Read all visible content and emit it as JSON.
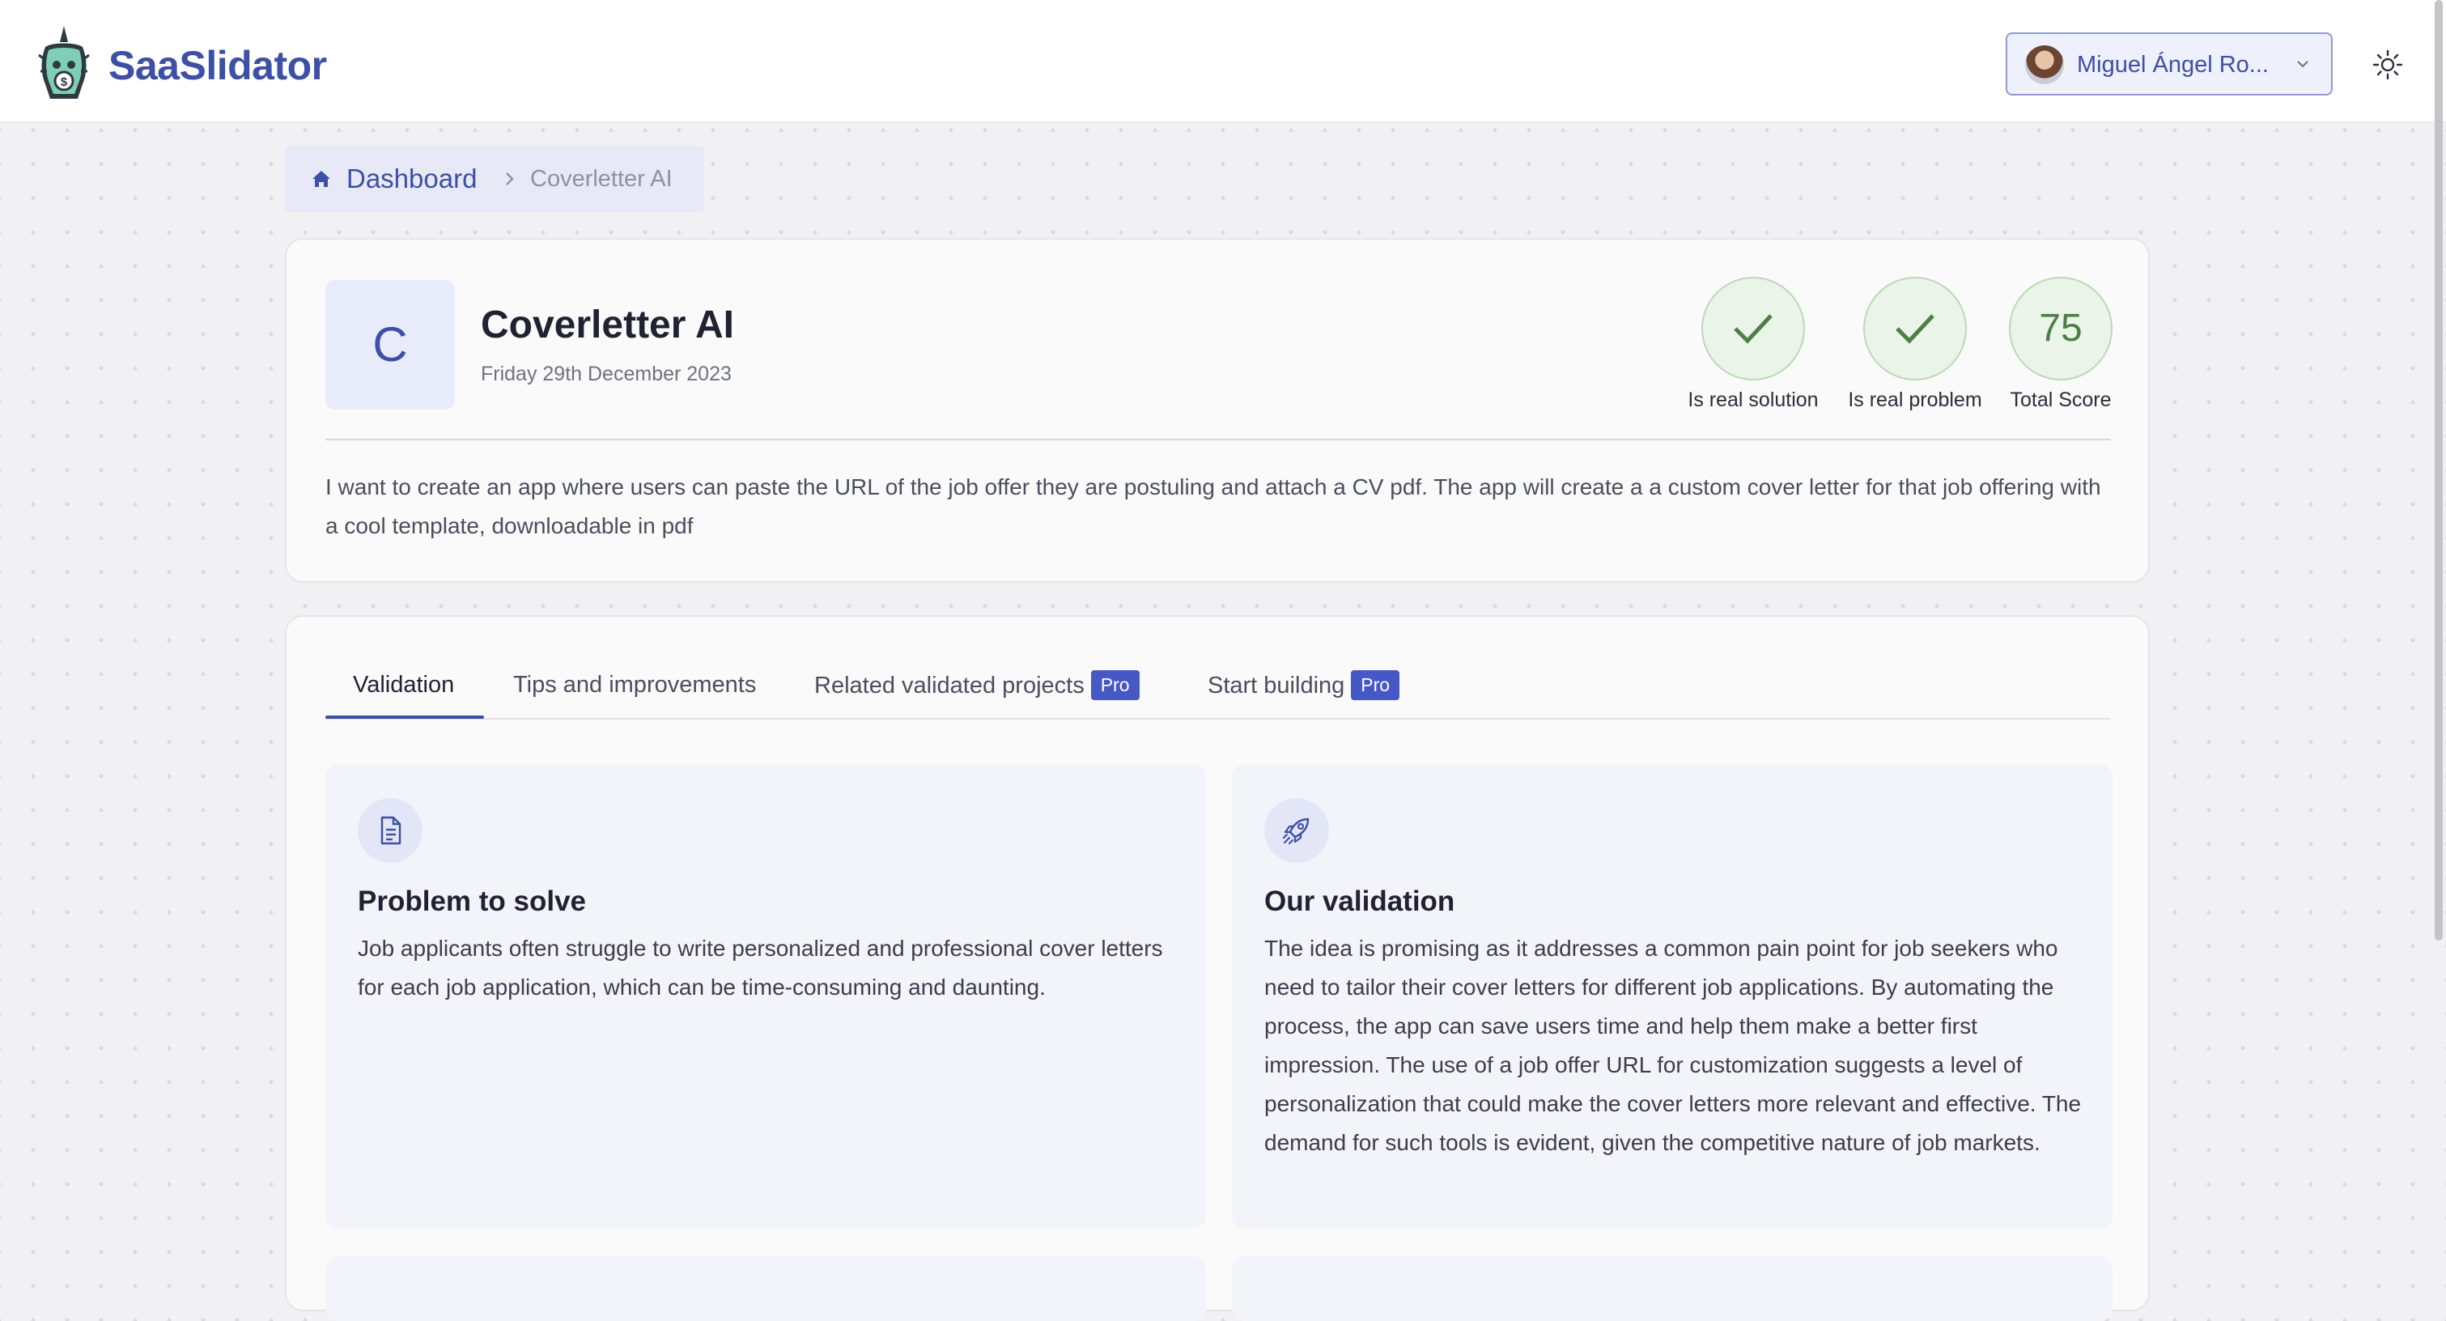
{
  "app": {
    "name": "SaaSlidator"
  },
  "user": {
    "name": "Miguel Ángel Ro..."
  },
  "breadcrumb": {
    "home": "Dashboard",
    "current": "Coverletter AI"
  },
  "project": {
    "initial": "C",
    "title": "Coverletter AI",
    "date": "Friday 29th December 2023",
    "description": "I want to create an app where users can paste the URL of the job offer they are postuling and attach a CV pdf. The app will create a a custom cover letter for that job offering with a cool template, downloadable in pdf",
    "scores": [
      {
        "label": "Is real solution",
        "value": "check"
      },
      {
        "label": "Is real problem",
        "value": "check"
      },
      {
        "label": "Total Score",
        "value": "75"
      }
    ]
  },
  "tabs": [
    {
      "label": "Validation",
      "active": true
    },
    {
      "label": "Tips and improvements"
    },
    {
      "label": "Related validated projects",
      "badge": "Pro"
    },
    {
      "label": "Start building",
      "badge": "Pro"
    }
  ],
  "sections": [
    {
      "icon": "document-icon",
      "title": "Problem to solve",
      "text": "Job applicants often struggle to write personalized and professional cover letters for each job application, which can be time-consuming and daunting."
    },
    {
      "icon": "rocket-icon",
      "title": "Our validation",
      "text": "The idea is promising as it addresses a common pain point for job seekers who need to tailor their cover letters for different job applications. By automating the process, the app can save users time and help them make a better first impression. The use of a job offer URL for customization suggests a level of personalization that could make the cover letters more relevant and effective. The demand for such tools is evident, given the competitive nature of job markets."
    }
  ],
  "colors": {
    "accent": "#3d4fa6",
    "pro_badge": "#4658c6",
    "score_green": "#4c7f45"
  }
}
